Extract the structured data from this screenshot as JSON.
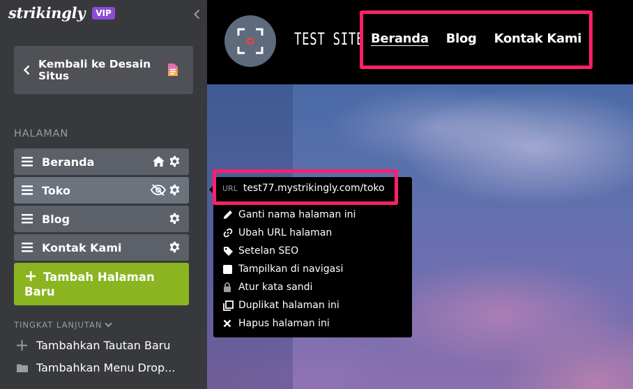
{
  "sidebar": {
    "brand": "strikingly",
    "badge": "VIP",
    "back_label": "Kembali ke Desain Situs",
    "section_title": "HALAMAN",
    "pages": [
      {
        "label": "Beranda"
      },
      {
        "label": "Toko"
      },
      {
        "label": "Blog"
      },
      {
        "label": "Kontak Kami"
      }
    ],
    "add_page": "Tambah Halaman Baru",
    "advanced_title": "TINGKAT LANJUTAN",
    "advanced_links": [
      {
        "label": "Tambahkan Tautan Baru",
        "icon": "plus-icon"
      },
      {
        "label": "Tambahkan Menu Drop...",
        "icon": "folder-icon"
      }
    ]
  },
  "site": {
    "title": "TEST SITE",
    "nav": [
      "Beranda",
      "Blog",
      "Kontak Kami"
    ]
  },
  "popup": {
    "url_tag": "URL",
    "url_value": "test77.mystrikingly.com/toko",
    "items": [
      {
        "label": "Ganti nama halaman ini",
        "icon": "pencil-icon"
      },
      {
        "label": "Ubah URL halaman",
        "icon": "link-icon"
      },
      {
        "label": "Setelan SEO",
        "icon": "tag-icon"
      },
      {
        "label": "Tampilkan di navigasi",
        "icon": "checkbox-icon"
      },
      {
        "label": "Atur kata sandi",
        "icon": "lock-icon"
      },
      {
        "label": "Duplikat halaman ini",
        "icon": "copy-icon"
      },
      {
        "label": "Hapus halaman ini",
        "icon": "x-icon"
      }
    ]
  },
  "colors": {
    "sidebar_bg": "#38393c",
    "add_button": "#8ab521",
    "highlight": "#ff1f6d",
    "vip": "#8d4ad6"
  }
}
